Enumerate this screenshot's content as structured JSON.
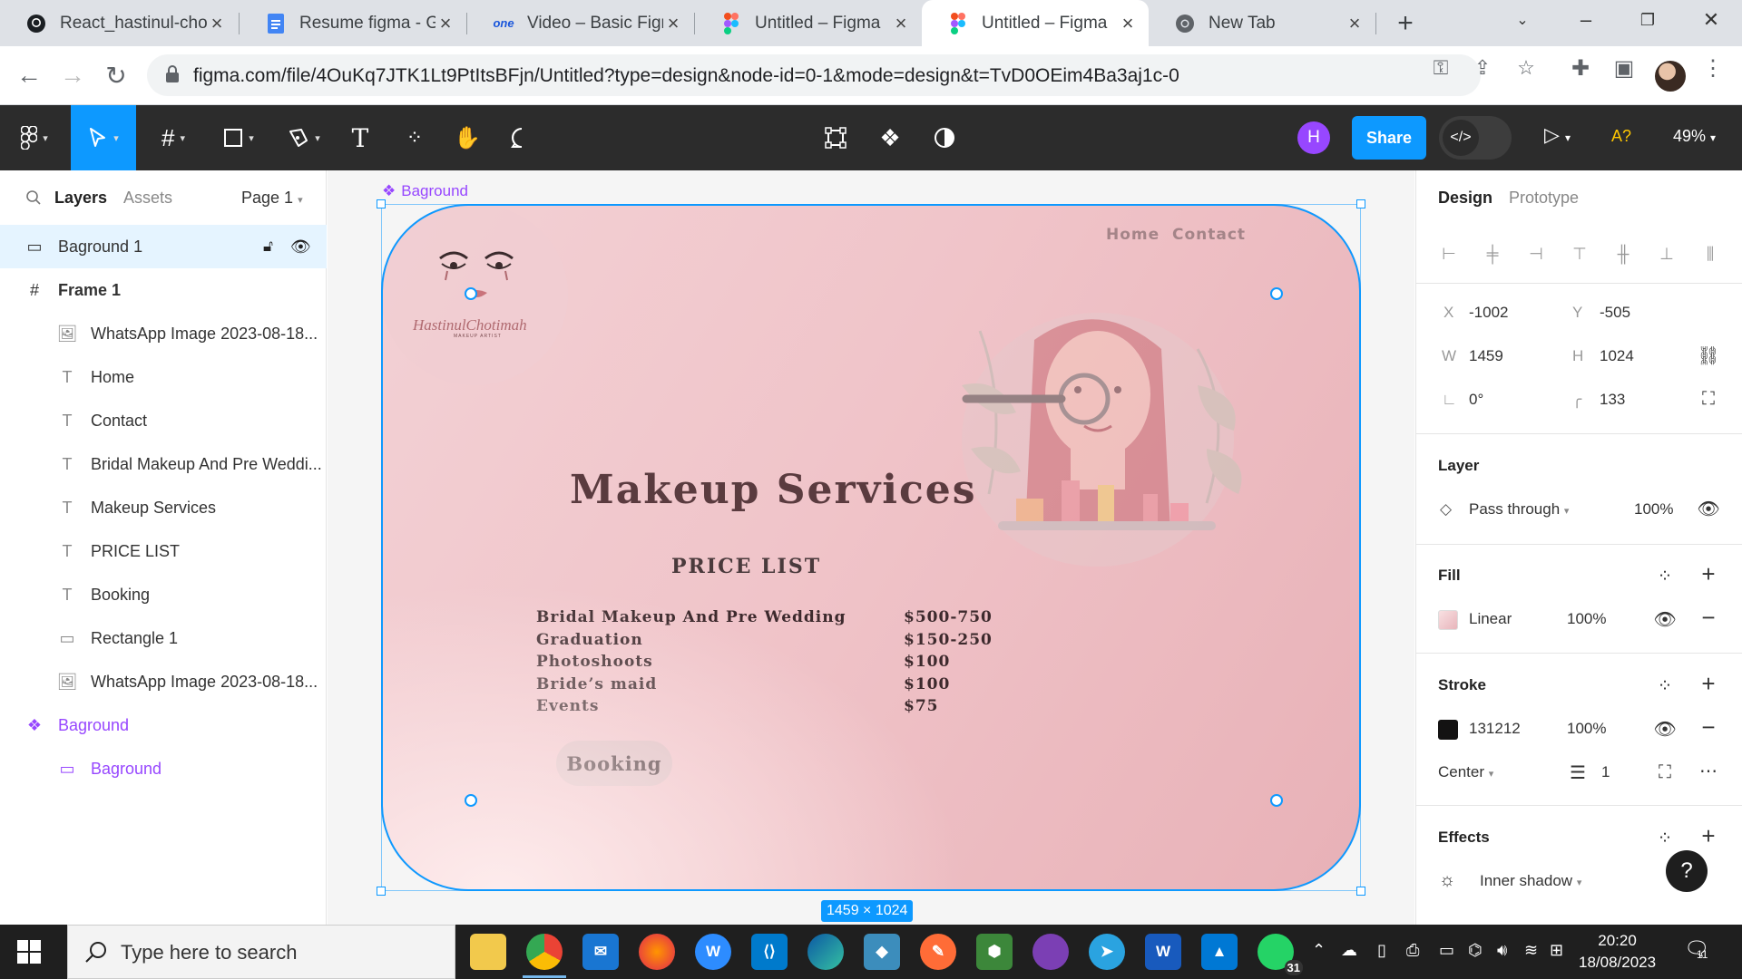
{
  "browser": {
    "tabs": [
      {
        "title": "React_hastinul-chot",
        "icon": "github-icon"
      },
      {
        "title": "Resume figma - Go",
        "icon": "google-docs-icon"
      },
      {
        "title": "Video – Basic Figma",
        "icon": "one-icon"
      },
      {
        "title": "Untitled – Figma",
        "icon": "figma-icon"
      },
      {
        "title": "Untitled – Figma",
        "icon": "figma-icon"
      },
      {
        "title": "New Tab",
        "icon": "chrome-icon"
      }
    ],
    "active_tab_index": 4,
    "url": "figma.com/file/4OuKq7JTK1Lt9PtItsBFjn/Untitled?type=design&node-id=0-1&mode=design&t=TvD0OEim4Ba3aj1c-0"
  },
  "figma_toolbar": {
    "user_initial": "H",
    "share_label": "Share",
    "accessibility_label": "A?",
    "zoom_label": "49%"
  },
  "layers_panel": {
    "tab_layers": "Layers",
    "tab_assets": "Assets",
    "page": "Page 1",
    "layers": [
      {
        "name": "Baground 1",
        "icon": "rectangle-icon"
      },
      {
        "name": "Frame 1",
        "icon": "frame-icon"
      },
      {
        "name": "WhatsApp Image 2023-08-18...",
        "icon": "image-icon"
      },
      {
        "name": "Home",
        "icon": "text-icon"
      },
      {
        "name": "Contact",
        "icon": "text-icon"
      },
      {
        "name": "Bridal Makeup And Pre Weddi...",
        "icon": "text-icon"
      },
      {
        "name": "Makeup Services",
        "icon": "text-icon"
      },
      {
        "name": "PRICE LIST",
        "icon": "text-icon"
      },
      {
        "name": "Booking",
        "icon": "text-icon"
      },
      {
        "name": "Rectangle 1",
        "icon": "rectangle-icon"
      },
      {
        "name": "WhatsApp Image 2023-08-18...",
        "icon": "image-icon"
      },
      {
        "name": "Baground",
        "icon": "component-icon"
      },
      {
        "name": "Baground",
        "icon": "rectangle-icon"
      }
    ]
  },
  "canvas": {
    "frame_label": "Baground",
    "size_tag": "1459 × 1024",
    "design": {
      "logo_text": "HastinulChotimah",
      "logo_sub": "MAKEUP ARTIST",
      "nav_home": "Home",
      "nav_contact": "Contact",
      "title": "Makeup Services",
      "price_list_heading": "PRICE LIST",
      "prices": [
        {
          "item": "Bridal Makeup And Pre Wedding",
          "price": "$500-750"
        },
        {
          "item": "Graduation",
          "price": "$150-250"
        },
        {
          "item": "Photoshoots",
          "price": "$100"
        },
        {
          "item": "Bride’s maid",
          "price": "$100"
        },
        {
          "item": "Events",
          "price": "$75"
        }
      ],
      "booking_label": "Booking"
    }
  },
  "design_panel": {
    "tab_design": "Design",
    "tab_prototype": "Prototype",
    "x_label": "X",
    "x": "-1002",
    "y_label": "Y",
    "y": "-505",
    "w_label": "W",
    "w": "1459",
    "h_label": "H",
    "h": "1024",
    "rotation": "0°",
    "radius": "133",
    "layer_heading": "Layer",
    "blend_mode": "Pass through",
    "layer_opacity": "100%",
    "fill_heading": "Fill",
    "fill_type": "Linear",
    "fill_opacity": "100%",
    "stroke_heading": "Stroke",
    "stroke_color": "131212",
    "stroke_opacity": "100%",
    "stroke_align": "Center",
    "stroke_weight": "1",
    "effects_heading": "Effects",
    "effect_type": "Inner shadow"
  },
  "taskbar": {
    "search_placeholder": "Type here to search",
    "time": "20:20",
    "date": "18/08/2023",
    "whatsapp_badge": "31",
    "notification_count": "11"
  },
  "colors": {
    "figma_blue": "#0d99ff",
    "figma_purple": "#9747ff",
    "toolbar_dark": "#2c2c2c",
    "stroke_swatch": "#131212"
  }
}
